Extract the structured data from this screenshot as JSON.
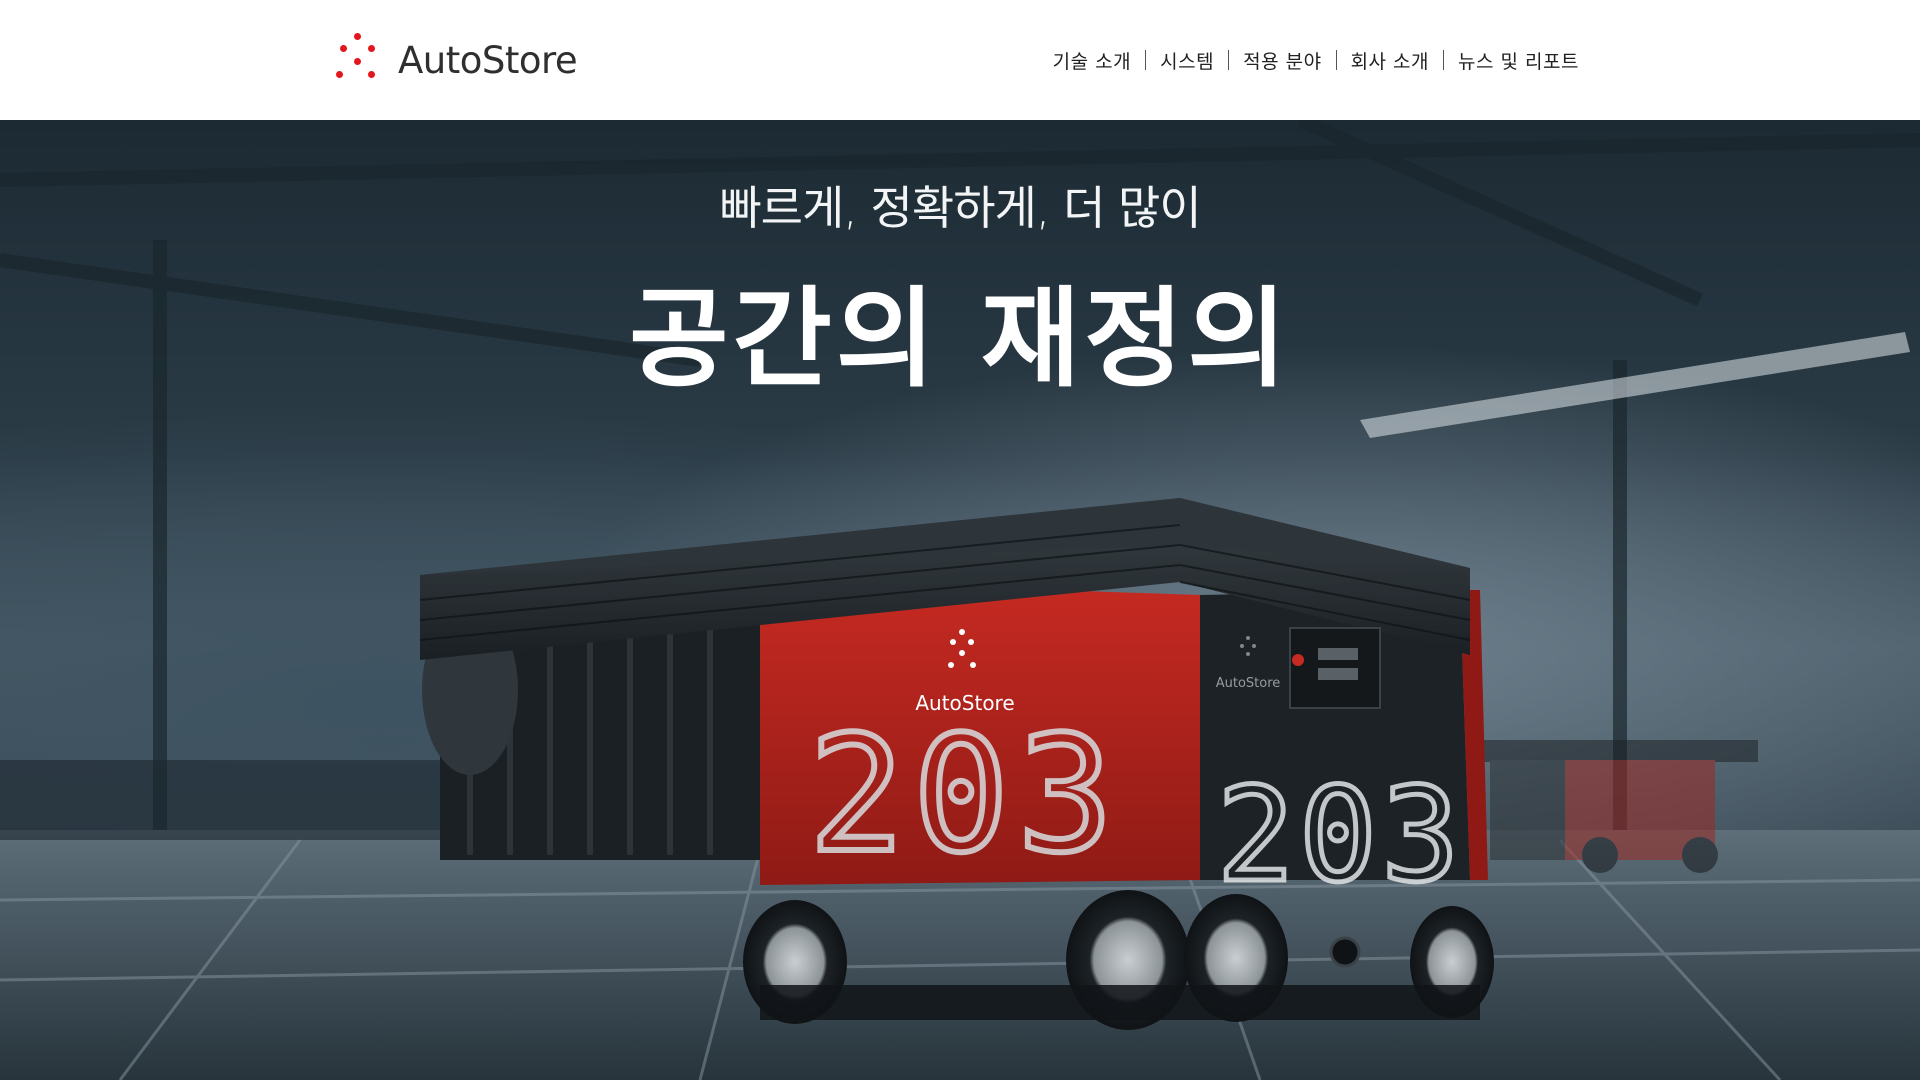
{
  "header": {
    "logo_text": "AutoStore",
    "nav": [
      {
        "label": "기술 소개"
      },
      {
        "label": "시스템"
      },
      {
        "label": "적용 분야"
      },
      {
        "label": "회사 소개"
      },
      {
        "label": "뉴스 및 리포트"
      }
    ]
  },
  "hero": {
    "subtitle": "빠르게, 정확하게, 더 많이",
    "title": "공간의 재정의",
    "robot_brand": "AutoStore",
    "robot_number": "203"
  },
  "colors": {
    "brand_red": "#e3161d",
    "robot_red": "#b3231c",
    "robot_dark": "#1d2226"
  }
}
